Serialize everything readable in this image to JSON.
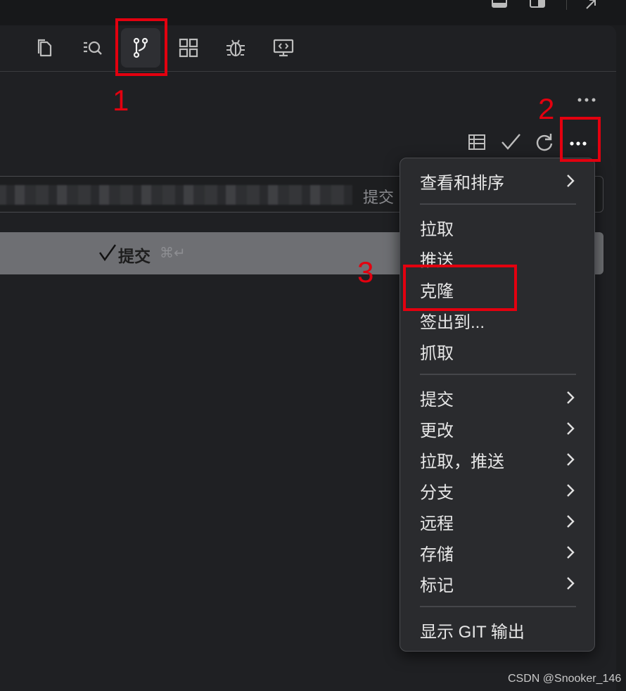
{
  "annotations": [
    "1",
    "2",
    "3"
  ],
  "activity_bar": {
    "items": [
      {
        "name": "explorer",
        "icon": "files-icon"
      },
      {
        "name": "search",
        "icon": "search-icon"
      },
      {
        "name": "source-control",
        "icon": "git-branch-icon",
        "active": true
      },
      {
        "name": "extensions",
        "icon": "extensions-grid-icon"
      },
      {
        "name": "debug",
        "icon": "bug-icon"
      },
      {
        "name": "remote",
        "icon": "remote-explorer-icon"
      }
    ]
  },
  "scm": {
    "commit_input_placeholder_visible": "提交",
    "commit_button_label": "提交",
    "commit_button_shortcut": "⌘↵"
  },
  "menu": {
    "view_sort": "查看和排序",
    "pull": "拉取",
    "push": "推送",
    "clone": "克隆",
    "checkout": "签出到...",
    "fetch": "抓取",
    "commit": "提交",
    "changes": "更改",
    "pull_push": "拉取，推送",
    "branch": "分支",
    "remote": "远程",
    "stash": "存储",
    "tags": "标记",
    "show_git_output": "显示 GIT 输出"
  },
  "watermark": "CSDN @Snooker_146",
  "colors": {
    "annotation": "#e3000f",
    "menu_bg": "#2a2b2e",
    "panel_bg": "#1f2023"
  }
}
